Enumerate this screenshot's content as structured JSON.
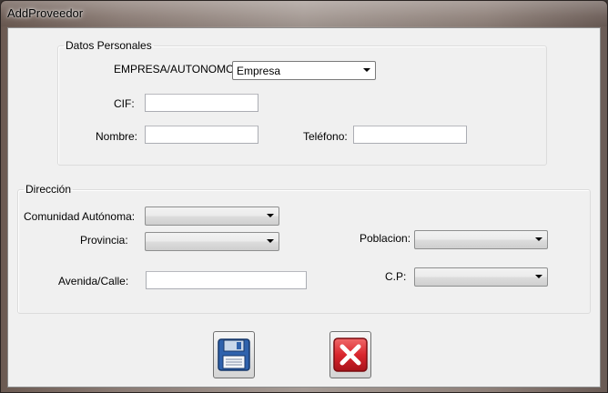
{
  "window": {
    "title": "AddProveedor"
  },
  "datos_personales": {
    "legend": "Datos Personales",
    "tipo_label": "EMPRESA/AUTONOMO:",
    "tipo_value": "Empresa",
    "cif_label": "CIF:",
    "cif_value": "",
    "nombre_label": "Nombre:",
    "nombre_value": "",
    "telefono_label": "Teléfono:",
    "telefono_value": ""
  },
  "direccion": {
    "legend": "Dirección",
    "comunidad_label": "Comunidad Autónoma:",
    "comunidad_value": "",
    "provincia_label": "Provincia:",
    "provincia_value": "",
    "poblacion_label": "Poblacion:",
    "poblacion_value": "",
    "avenida_label": "Avenida/Calle:",
    "avenida_value": "",
    "cp_label": "C.P:",
    "cp_value": ""
  },
  "buttons": {
    "save_icon": "floppy-disk-icon",
    "cancel_icon": "red-x-icon"
  },
  "colors": {
    "save_accent": "#3a6db5",
    "cancel_accent": "#d1202a"
  }
}
